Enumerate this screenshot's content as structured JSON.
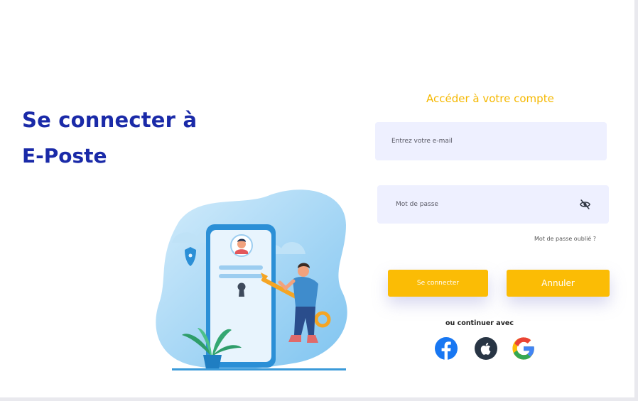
{
  "hero": {
    "line1": "Se connecter à",
    "line2": "E-Poste"
  },
  "form": {
    "title": "Accéder à votre compte",
    "email_placeholder": "Entrez votre e-mail",
    "password_placeholder": "Mot de passe",
    "forgot_label": "Mot de passe oublié ?",
    "login_label": "Se connecter",
    "cancel_label": "Annuler",
    "alt_label": "ou continuer avec"
  },
  "social": [
    {
      "name": "facebook-icon",
      "color": "#1877f2"
    },
    {
      "name": "apple-icon",
      "color": "#283544"
    },
    {
      "name": "google-icon",
      "color": "#4285f4"
    }
  ],
  "colors": {
    "brand_blue": "#1a2aa8",
    "accent_yellow": "#fbbc05",
    "title_yellow": "#f5b800",
    "field_bg": "#eef0ff"
  },
  "icons": {
    "password_toggle": "eye-off-icon"
  }
}
